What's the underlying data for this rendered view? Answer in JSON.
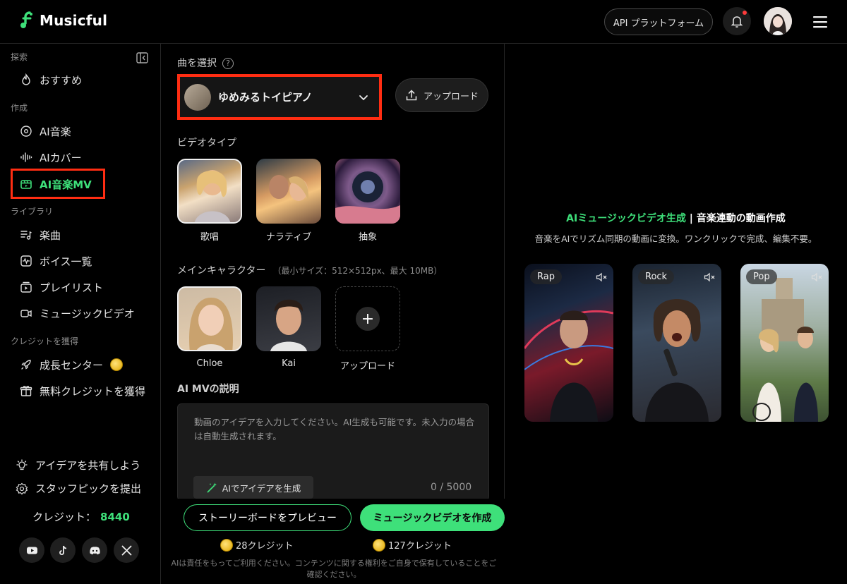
{
  "app": {
    "name": "Musicful"
  },
  "header": {
    "api_label": "API プラットフォーム"
  },
  "sidebar": {
    "sections": {
      "explore": "探索",
      "create": "作成",
      "library": "ライブラリ",
      "earn": "クレジットを獲得"
    },
    "items": {
      "recommended": "おすすめ",
      "ai_music": "AI音楽",
      "ai_cover": "AIカバー",
      "ai_music_mv": "AI音楽MV",
      "songs": "楽曲",
      "voices": "ボイス一覧",
      "playlists": "プレイリスト",
      "music_videos": "ミュージックビデオ",
      "growth_center": "成長センター",
      "free_credits": "無料クレジットを獲得"
    },
    "bottom": {
      "share_idea": "アイデアを共有しよう",
      "staff_pick": "スタッフピックを提出",
      "credits_label": "クレジット：",
      "credits_value": "8440"
    }
  },
  "center": {
    "song_select_label": "曲を選択",
    "selected_song": "ゆめみるトイピアノ",
    "upload_label": "アップロード",
    "video_type_label": "ビデオタイプ",
    "video_types": [
      "歌唱",
      "ナラティブ",
      "抽象"
    ],
    "main_character_label": "メインキャラクター",
    "main_character_hint": "（最小サイズ：512×512px、最大 10MB）",
    "characters": [
      "Chloe",
      "Kai"
    ],
    "character_upload": "アップロード",
    "description_label": "AI MVの説明",
    "description_placeholder": "動画のアイデアを入力してください。AI生成も可能です。未入力の場合は自動生成されます。",
    "generate_idea": "AIでアイデアを生成",
    "char_count": "0 / 5000",
    "preview_button": "ストーリーボードをプレビュー",
    "create_button": "ミュージックビデオを作成",
    "preview_cost": "28クレジット",
    "create_cost": "127クレジット",
    "disclaimer": "AIは責任をもってご利用ください。コンテンツに関する権利をご自身で保有していることをご確認ください。"
  },
  "right": {
    "title_highlight": "AIミュージックビデオ生成",
    "title_rest": " | 音楽連動の動画作成",
    "subtitle": "音楽をAIでリズム同期の動画に変換。ワンクリックで完成、編集不要。",
    "cards": [
      "Rap",
      "Rock",
      "Pop"
    ]
  },
  "colors": {
    "accent": "#3ee07a",
    "highlight_box": "#ff2d12"
  }
}
